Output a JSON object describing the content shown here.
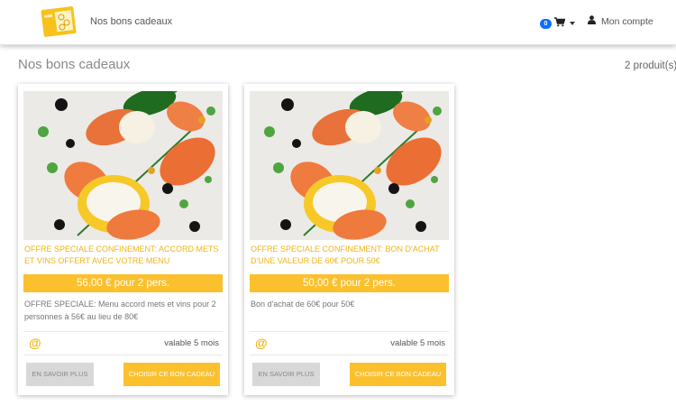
{
  "header": {
    "brand": "Nos bons cadeaux",
    "cart_count": "0",
    "account_label": "Mon compte"
  },
  "page": {
    "title": "Nos bons cadeaux",
    "count": "2 produit(s)"
  },
  "cards": [
    {
      "title": "OFFRE SPECIALE CONFINEMENT: ACCORD METS ET VINS OFFERT AVEC VOTRE MENU",
      "price": "56,00 € pour 2 pers.",
      "description": "OFFRE SPECIALE: Menu accord mets et vins pour 2 personnes à 56€ au lieu de 80€",
      "validity": "valable 5 mois",
      "more_label": "EN SAVOIR PLUS",
      "choose_label": "CHOISIR CE BON CADEAU"
    },
    {
      "title": "OFFRE SPECIALE CONFINEMENT: BON D'ACHAT D'UNE VALEUR DE 60€ POUR 50€",
      "price": "50,00 € pour 2 pers.",
      "description": "Bon d'achat de 60€ pour 50€",
      "validity": "valable 5 mois",
      "more_label": "EN SAVOIR PLUS",
      "choose_label": "CHOISIR CE BON CADEAU"
    }
  ],
  "icons": {
    "logo": "gift-voucher-logo",
    "cart": "shopping-cart-icon",
    "account": "user-icon",
    "validity": "at-icon"
  },
  "colors": {
    "accent": "#fbc02d",
    "title_accent": "#f0b419",
    "badge": "#0d6efd"
  }
}
